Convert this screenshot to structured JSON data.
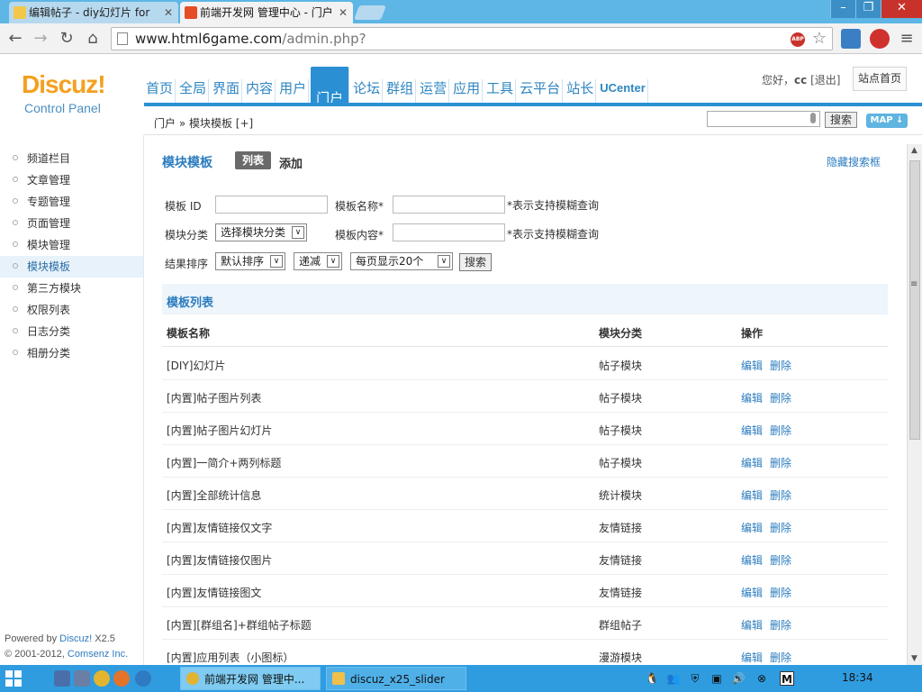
{
  "browser": {
    "tabs": [
      {
        "title": "编辑帖子 - diy幻灯片 for"
      },
      {
        "title": "前端开发网 管理中心 - 门户"
      }
    ],
    "url_host": "www.html6game.com",
    "url_path": "/admin.php?",
    "abp_label": "ABP"
  },
  "header": {
    "logo": "Discuz!",
    "logo_sub": "Control Panel",
    "nav": [
      "首页",
      "全局",
      "界面",
      "内容",
      "用户",
      "门户",
      "论坛",
      "群组",
      "运营",
      "应用",
      "工具",
      "云平台",
      "站长",
      "UCenter"
    ],
    "active_nav": "门户",
    "greeting": "您好，",
    "username": "cc",
    "logout": "[退出]",
    "site_home": "站点首页"
  },
  "subbar": {
    "breadcrumb": "门户 » 模块模板  [+]",
    "search_button": "搜索",
    "map_button": "MAP ↓"
  },
  "sidebar": {
    "items": [
      "频道栏目",
      "文章管理",
      "专题管理",
      "页面管理",
      "模块管理",
      "模块模板",
      "第三方模块",
      "权限列表",
      "日志分类",
      "相册分类"
    ],
    "active": "模块模板",
    "powered_prefix": "Powered by ",
    "powered_brand": "Discuz!",
    "powered_version": " X2.5",
    "copyright_prefix": "© 2001-2012, ",
    "copyright_brand": "Comsenz Inc."
  },
  "main": {
    "title": "模块模板",
    "tab_list": "列表",
    "tab_add": "添加",
    "hide_search": "隐藏搜索框",
    "form": {
      "template_id_label": "模板 ID",
      "template_name_label": "模板名称*",
      "fuzzy_hint_1": "*表示支持模糊查询",
      "category_label": "模块分类",
      "category_select": "选择模块分类",
      "content_label": "模板内容*",
      "fuzzy_hint_2": "*表示支持模糊查询",
      "sort_label": "结果排序",
      "sort_select": "默认排序",
      "order_select": "递减",
      "per_page_select": "每页显示20个",
      "search_button": "搜索"
    },
    "list_title": "模板列表",
    "columns": [
      "模板名称",
      "模块分类",
      "操作"
    ],
    "op_edit": "编辑",
    "op_delete": "删除",
    "rows": [
      {
        "name": "[DIY]幻灯片",
        "category": "帖子模块"
      },
      {
        "name": "[内置]帖子图片列表",
        "category": "帖子模块"
      },
      {
        "name": "[内置]帖子图片幻灯片",
        "category": "帖子模块"
      },
      {
        "name": "[内置]一简介+两列标题",
        "category": "帖子模块"
      },
      {
        "name": "[内置]全部统计信息",
        "category": "统计模块"
      },
      {
        "name": "[内置]友情链接仅文字",
        "category": "友情链接"
      },
      {
        "name": "[内置]友情链接仅图片",
        "category": "友情链接"
      },
      {
        "name": "[内置]友情链接图文",
        "category": "友情链接"
      },
      {
        "name": "[内置][群组名]+群组帖子标题",
        "category": "群组帖子"
      },
      {
        "name": "[内置]应用列表（小图标）",
        "category": "漫游模块"
      }
    ]
  },
  "taskbar": {
    "tasks": [
      "前端开发网 管理中...",
      "discuz_x25_slider"
    ],
    "tray_m": "M",
    "clock": "18:34"
  }
}
